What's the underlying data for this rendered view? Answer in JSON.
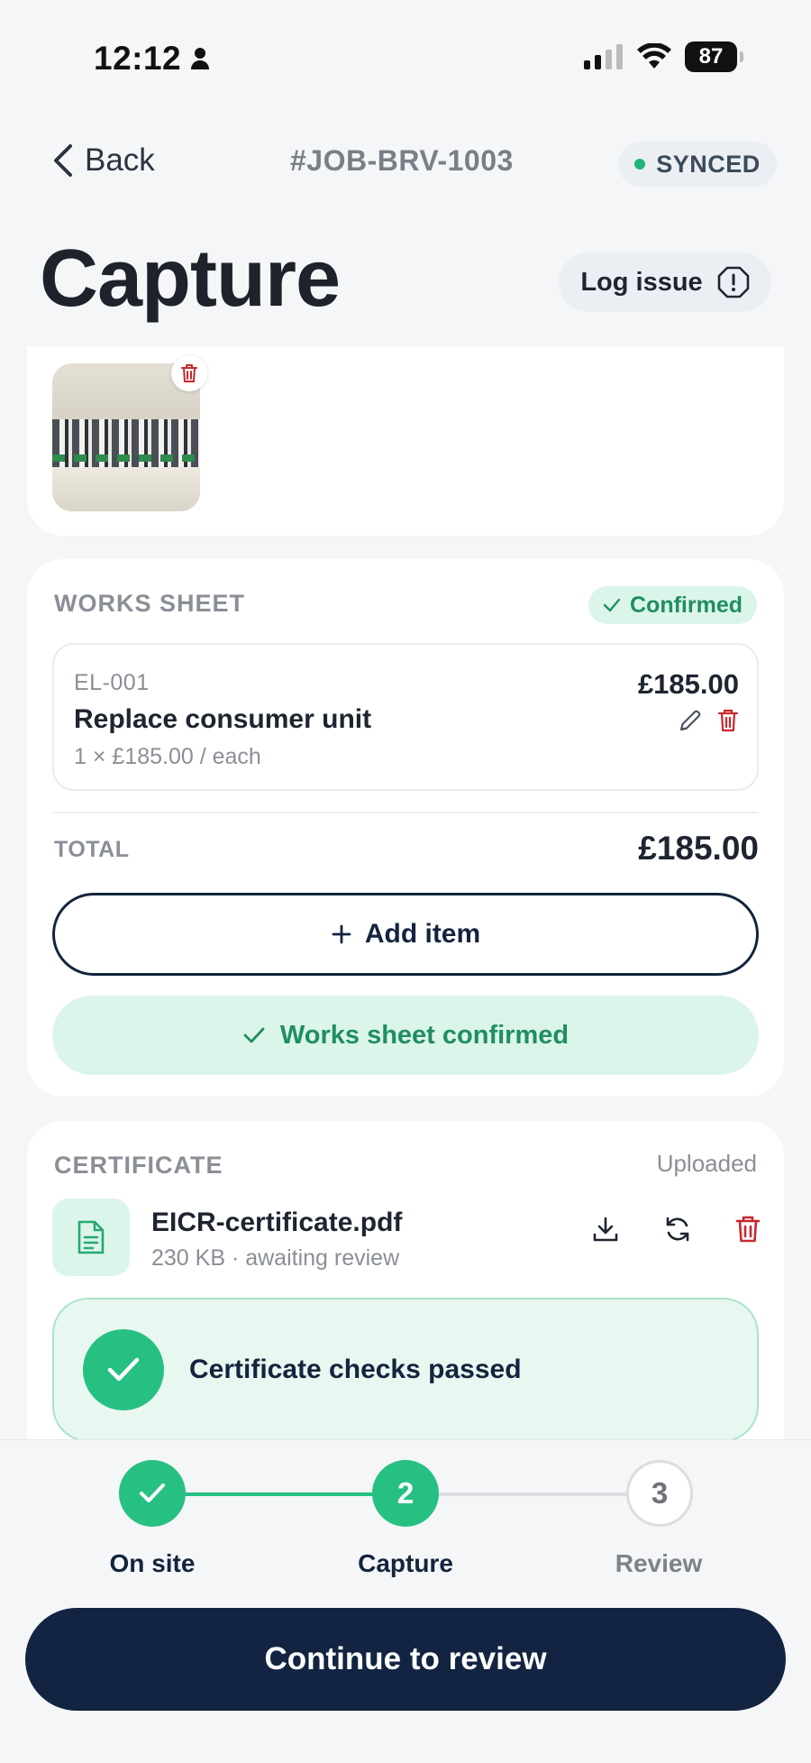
{
  "status_bar": {
    "time": "12:12",
    "battery": "87"
  },
  "header": {
    "back_label": "Back",
    "job_id": "#JOB-BRV-1003",
    "sync_status": "SYNCED",
    "title": "Capture",
    "log_issue_label": "Log issue"
  },
  "works_sheet": {
    "section_label": "WORKS SHEET",
    "badge": "Confirmed",
    "items": [
      {
        "code": "EL-001",
        "name": "Replace consumer unit",
        "qty_line": "1 × £185.00 / each",
        "price": "£185.00"
      }
    ],
    "total_label": "TOTAL",
    "total_value": "£185.00",
    "add_item_label": "Add item",
    "confirmed_label": "Works sheet confirmed"
  },
  "certificate": {
    "section_label": "CERTIFICATE",
    "status": "Uploaded",
    "file_name": "EICR-certificate.pdf",
    "file_meta": "230 KB · awaiting review",
    "checks_label": "Certificate checks passed"
  },
  "stepper": {
    "steps": [
      {
        "number": "1",
        "label": "On site",
        "state": "done"
      },
      {
        "number": "2",
        "label": "Capture",
        "state": "current"
      },
      {
        "number": "3",
        "label": "Review",
        "state": "upcoming"
      }
    ]
  },
  "continue_label": "Continue to review",
  "colors": {
    "accent_green": "#27c083",
    "navy": "#122441",
    "danger_red": "#c8282d"
  }
}
